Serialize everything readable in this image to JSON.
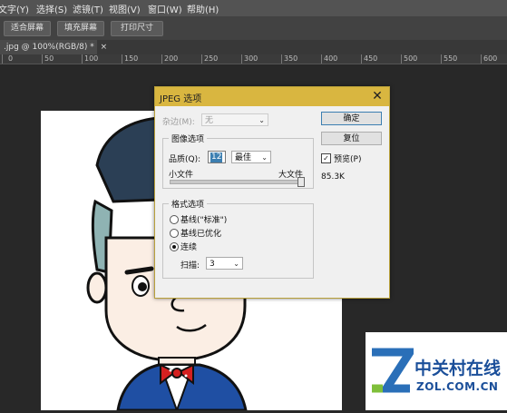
{
  "menubar": {
    "items": [
      "文字(Y)",
      "选择(S)",
      "滤镜(T)",
      "视图(V)",
      "窗口(W)",
      "帮助(H)"
    ]
  },
  "options_bar": {
    "buttons": [
      "适合屏幕",
      "填充屏幕",
      "打印尺寸"
    ]
  },
  "document": {
    "tab_label": ".jpg @ 100%(RGB/8) *",
    "tab_close": "×"
  },
  "ruler": {
    "labels": [
      "0",
      "50",
      "100",
      "150",
      "200",
      "250",
      "300",
      "350",
      "400",
      "450",
      "500",
      "550",
      "600"
    ]
  },
  "dialog": {
    "title": "JPEG 选项",
    "close": "✕",
    "matte_label": "杂边(M):",
    "matte_value": "无",
    "image_options_title": "图像选项",
    "quality_label": "品质(Q):",
    "quality_value": "12",
    "quality_preset": "最佳",
    "small_file": "小文件",
    "large_file": "大文件",
    "slider_level": 1.0,
    "format_options_title": "格式选项",
    "format_options": [
      "基线(\"标准\")",
      "基线已优化",
      "连续"
    ],
    "selected_format": 2,
    "scans_label": "扫描:",
    "scans_value": "3",
    "ok_button": "确定",
    "reset_button": "复位",
    "preview_label": "预览(P)",
    "preview_checked": true,
    "file_size": "85.3K"
  },
  "watermark": {
    "brand": "中关村在线",
    "domain": "ZOL.COM.CN"
  },
  "colors": {
    "dialog_title": "#d9b640",
    "workspace": "#282828",
    "suit": "#1f4fa3",
    "bowtie": "#d42020",
    "hair": "#2b3f55"
  }
}
